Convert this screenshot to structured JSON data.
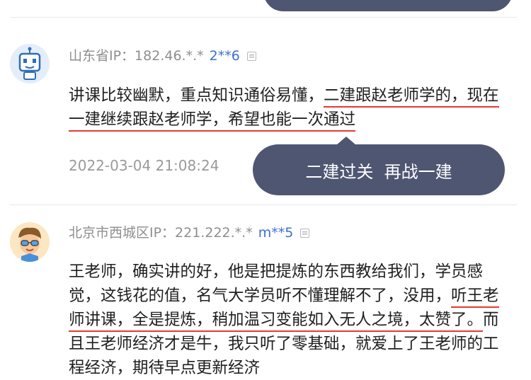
{
  "comments": [
    {
      "location": "山东省IP：182.46.*.*",
      "user": "2**6",
      "text_lines": [
        [
          "讲课比较幽默，重点知识通俗易懂，",
          "二建跟赵老师学的，现在"
        ],
        [
          "一建继续跟赵老师学，希望也能一次通过"
        ]
      ],
      "date": "2022-03-04 21:08:24",
      "tag": "二建过关  再战一建"
    },
    {
      "location": "北京市西城区IP：221.222.*.*",
      "user": "m**5",
      "text_lines": [
        [
          "王老师，确实讲的好，他是把提炼的东西教给我们，学员感"
        ],
        [
          "觉，这钱花的值，名气大学员听不懂理解不了，没用，",
          "听王老"
        ],
        [
          "师讲课，全是提炼，稍加温习变能如入无人之境，太赞了。",
          "而"
        ],
        [
          "且王老师经济才是牛，我只听了零基础，就爱上了王老师的工"
        ],
        [
          "程经济，期待早点更新经济"
        ]
      ]
    }
  ]
}
